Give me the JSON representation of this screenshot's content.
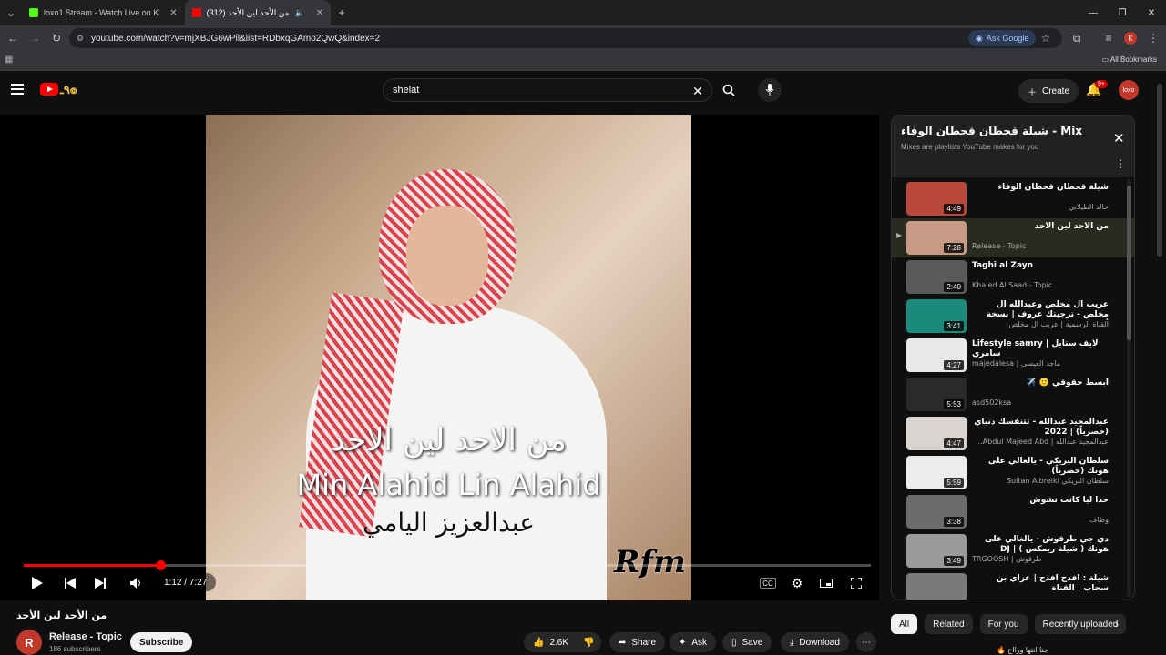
{
  "browser": {
    "tabs": [
      {
        "title": "loxo1 Stream - Watch Live on K",
        "favicon_color": "#53fc18",
        "active": false
      },
      {
        "title": "من الأحد لين الأحد (312)",
        "favicon_color": "#ff0000",
        "active": true
      }
    ],
    "url": "youtube.com/watch?v=mjXBJG6wPil&list=RDbxqGAmo2QwQ&index=2",
    "ask_google": "Ask Google",
    "all_bookmarks": "All Bookmarks",
    "profile_initial": "K"
  },
  "yt": {
    "search_value": "shelat",
    "create_label": "Create",
    "notif_badge": "9+",
    "avatar_label": "loxo"
  },
  "player": {
    "caption_ar": "من الاحد لين الاحد",
    "caption_en": "Min Alahid Lin Alahid",
    "caption_artist": "عبدالعزيز اليامي",
    "watermark": "Rfm",
    "time": "1:12 / 7:27",
    "progress_fraction": 0.161
  },
  "video": {
    "title": "من الأحد لين الأحد",
    "channel_initial": "R",
    "channel": "Release - Topic",
    "subscribers": "186 subscribers",
    "subscribe_label": "Subscribe",
    "likes": "2.6K",
    "share": "Share",
    "ask": "Ask",
    "save": "Save",
    "download": "Download"
  },
  "mix": {
    "title": "شيلة قحطان قحطان الوفاء - Mix",
    "subtitle": "Mixes are playlists YouTube makes for you",
    "items": [
      {
        "title": "شيلة قحطان قحطان الوفاء",
        "artist": "خالد الطيلاني",
        "duration": "4:49",
        "current": false,
        "thumb": "#b8483a"
      },
      {
        "title": "من الأحد لين الأحد",
        "artist": "Release - Topic",
        "duration": "7:28",
        "current": true,
        "thumb": "#c79a84"
      },
      {
        "title": "Taghi al Zayn",
        "artist": "Khaled Al Saad - Topic",
        "duration": "2:40",
        "current": false,
        "thumb": "#5a5a5a"
      },
      {
        "title": "عريب ال مخلص وعبدالله ال مخلص - ترجيتك عروف | نسخة أصلية",
        "artist": "القناة الرسمية | عريب ال مخلص",
        "duration": "3:41",
        "current": false,
        "thumb": "#1a8a7a"
      },
      {
        "title": "Lifestyle samry | لايف ستايل سامري",
        "artist": "majedalesa | ماجد العيسى",
        "duration": "4:27",
        "current": false,
        "thumb": "#e8e8e8"
      },
      {
        "title": "ابسط حقوقي 🙂 ✈️",
        "artist": "asd502ksa",
        "duration": "5:53",
        "current": false,
        "thumb": "#2a2a2a"
      },
      {
        "title": "عبدالمجيد عبدالله - تتنفسك دنياي (حصرياً) | 2022",
        "artist": "عبدالمجيد عبدالله | Abdul Majeed Abd...",
        "duration": "4:47",
        "current": false,
        "thumb": "#d9d4cf"
      },
      {
        "title": "سلطان البريكي - يالغالي على هونك (حصرياً)",
        "artist": "سلطان البريكي Sultan Albreiki",
        "duration": "5:59",
        "current": false,
        "thumb": "#ececec"
      },
      {
        "title": "حدا ليا كانت نشوش",
        "artist": "وطاف",
        "duration": "3:38",
        "current": false,
        "thumb": "#6b6b6b"
      },
      {
        "title": "دي جي طرقوش - يالغالي على هونك ( شيلة ريمكس ) | DJ TRGOOSH - ya...",
        "artist": "TRGOOSH | طرقوش",
        "duration": "3:49",
        "current": false,
        "thumb": "#9a9a9a"
      },
      {
        "title": "شيلة : افدح افدح | عزاي بن سحاب | القناة",
        "artist": "",
        "duration": "",
        "current": false,
        "thumb": "#7a7a7a"
      }
    ]
  },
  "chips": [
    "All",
    "Related",
    "For you",
    "Recently uploaded"
  ],
  "next_row_text": "جتا انتها ورااح 🔥"
}
